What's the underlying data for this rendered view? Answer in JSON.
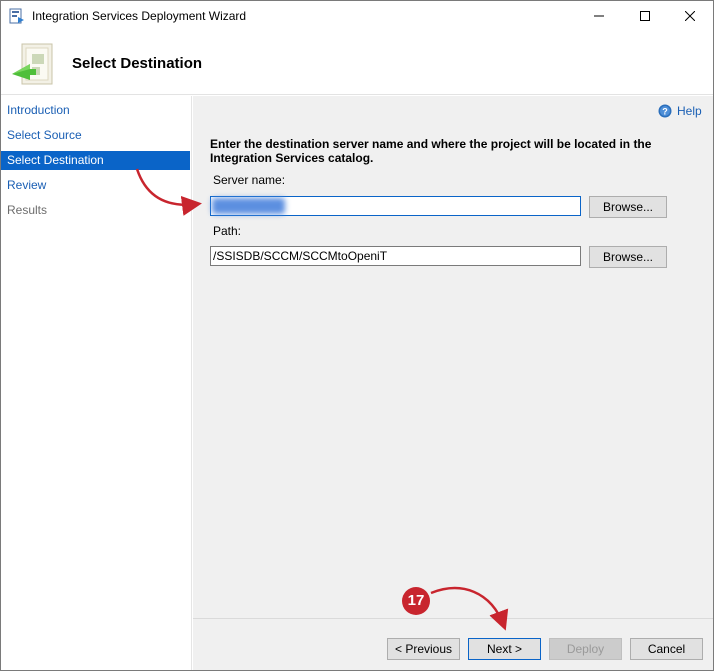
{
  "window": {
    "title": "Integration Services Deployment Wizard"
  },
  "header": {
    "title": "Select Destination"
  },
  "sidebar": {
    "items": [
      {
        "label": "Introduction"
      },
      {
        "label": "Select Source"
      },
      {
        "label": "Select Destination"
      },
      {
        "label": "Review"
      },
      {
        "label": "Results"
      }
    ]
  },
  "content": {
    "help_label": "Help",
    "instructions": "Enter the destination server name and where the project will be located in the Integration Services catalog.",
    "server_name_label": "Server name:",
    "server_name_value": "",
    "path_label": "Path:",
    "path_value": "/SSISDB/SCCM/SCCMtoOpeniT",
    "browse_label": "Browse..."
  },
  "footer": {
    "previous_label": "< Previous",
    "next_label": "Next >",
    "deploy_label": "Deploy",
    "cancel_label": "Cancel"
  },
  "annotation": {
    "step_number": "17",
    "color": "#c8252e"
  },
  "colors": {
    "selection": "#0a64c8",
    "link": "#1a5fb4"
  }
}
